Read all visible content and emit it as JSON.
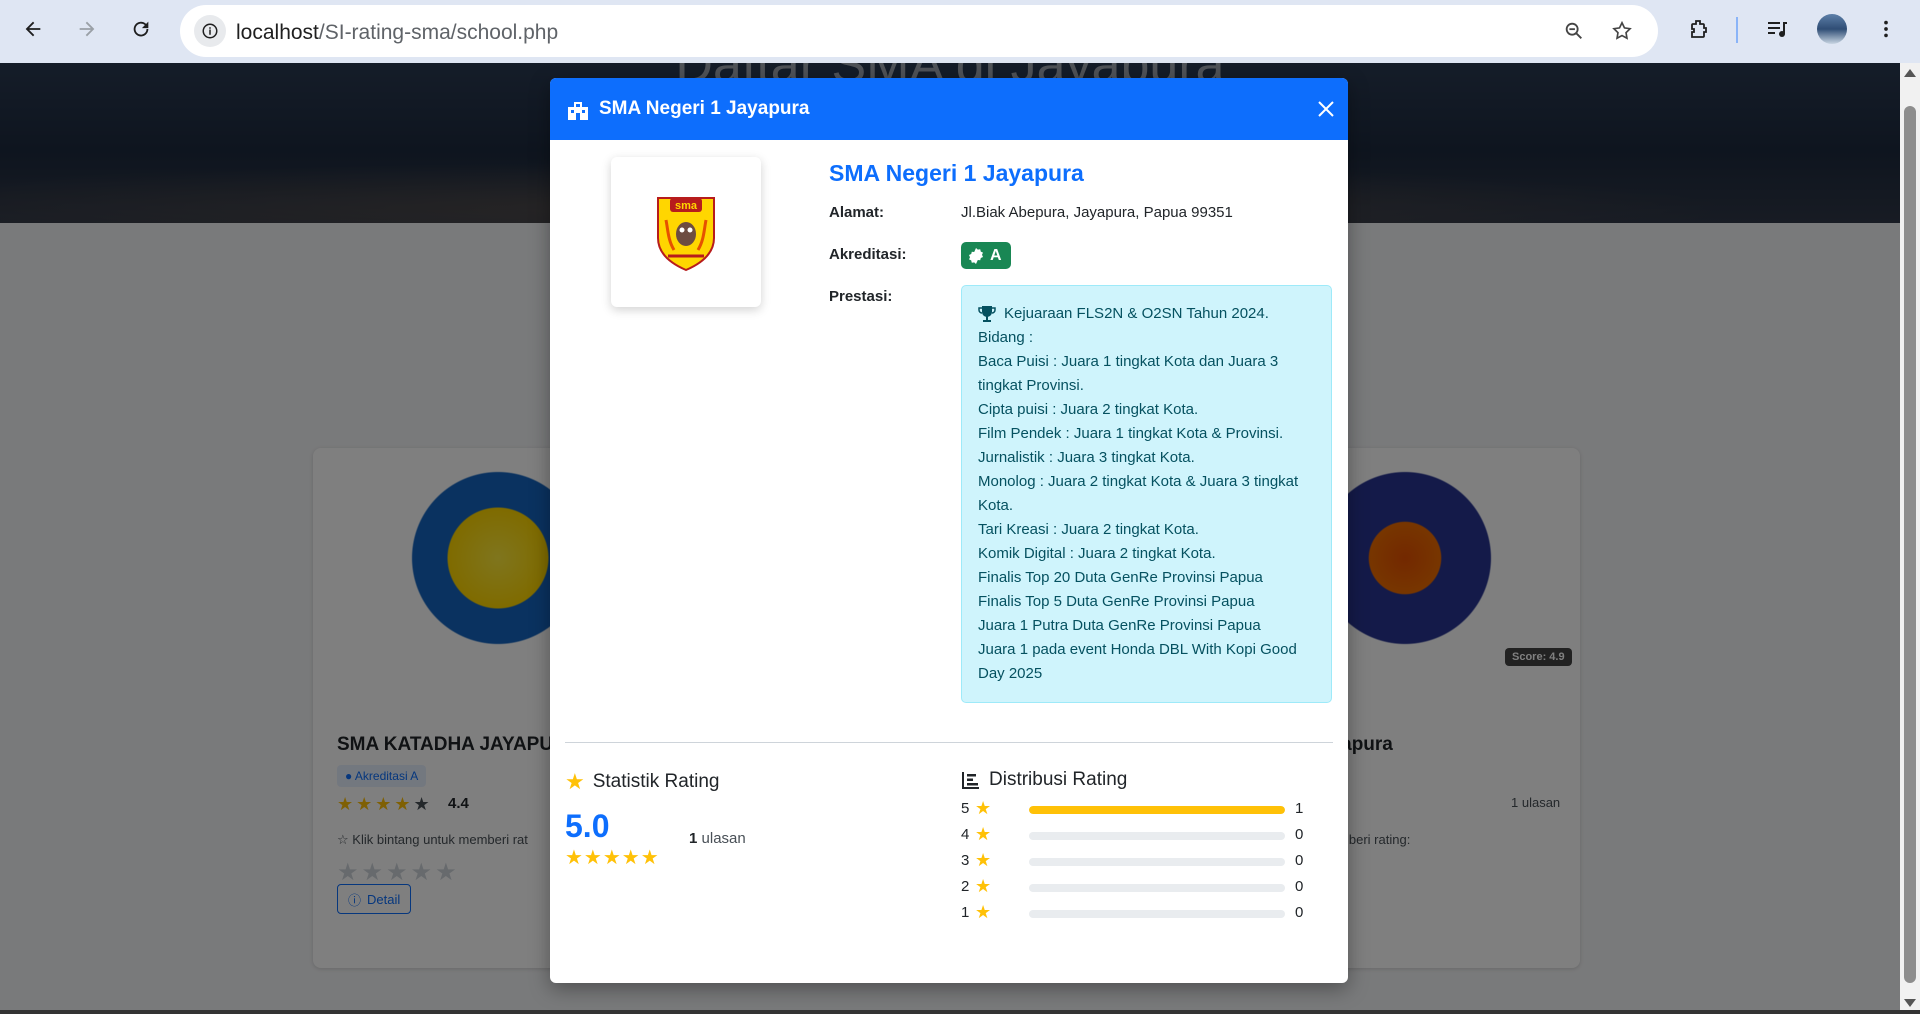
{
  "browser": {
    "url_host": "localhost",
    "url_path": "/SI-rating-sma/school.php"
  },
  "background": {
    "hero_title": "Daftar SMA di Jayapura",
    "cards": [
      {
        "title": "SMA KATADHA JAYAPU",
        "badge": "Akreditasi A",
        "score": "4.4",
        "hint": "Klik bintang untuk memberi rat",
        "detail_label": "Detail"
      },
      {
        "title": "ayapura",
        "score_pill": "Score: 4.9",
        "ulasan": "1 ulasan",
        "hint": "memberi rating:"
      }
    ]
  },
  "modal": {
    "header_title": "SMA Negeri 1 Jayapura",
    "school_name": "SMA Negeri 1 Jayapura",
    "alamat_label": "Alamat:",
    "alamat_value": "Jl.Biak Abepura, Jayapura, Papua 99351",
    "akreditasi_label": "Akreditasi:",
    "akreditasi_value": "A",
    "prestasi_label": "Prestasi:",
    "prestasi_lines": [
      "Kejuaraan FLS2N & O2SN Tahun 2024.",
      "Bidang :",
      "Baca Puisi : Juara 1 tingkat Kota dan Juara 3 tingkat Provinsi.",
      "Cipta puisi : Juara 2 tingkat Kota.",
      "Film Pendek : Juara 1 tingkat Kota & Provinsi.",
      "Jurnalistik : Juara 3 tingkat Kota.",
      "Monolog : Juara 2 tingkat Kota & Juara 3 tingkat Kota.",
      "Tari Kreasi : Juara 2 tingkat Kota.",
      "Komik Digital : Juara 2 tingkat Kota.",
      "Finalis Top 20 Duta GenRe Provinsi Papua",
      "Finalis Top 5 Duta GenRe Provinsi Papua",
      "Juara 1 Putra Duta GenRe Provinsi Papua",
      "Juara 1 pada event Honda DBL With Kopi Good Day 2025"
    ],
    "statistik_title": "Statistik Rating",
    "average": "5.0",
    "review_count": "1",
    "review_label": "ulasan",
    "distribusi_title": "Distribusi Rating",
    "distribution": [
      {
        "stars": "5",
        "count": "1",
        "fraction": 1.0
      },
      {
        "stars": "4",
        "count": "0",
        "fraction": 0
      },
      {
        "stars": "3",
        "count": "0",
        "fraction": 0
      },
      {
        "stars": "2",
        "count": "0",
        "fraction": 0
      },
      {
        "stars": "1",
        "count": "0",
        "fraction": 0
      }
    ]
  },
  "colors": {
    "primary": "#0d6efd",
    "success": "#198754",
    "star": "#ffc107",
    "info_bg": "#cff4fc"
  }
}
